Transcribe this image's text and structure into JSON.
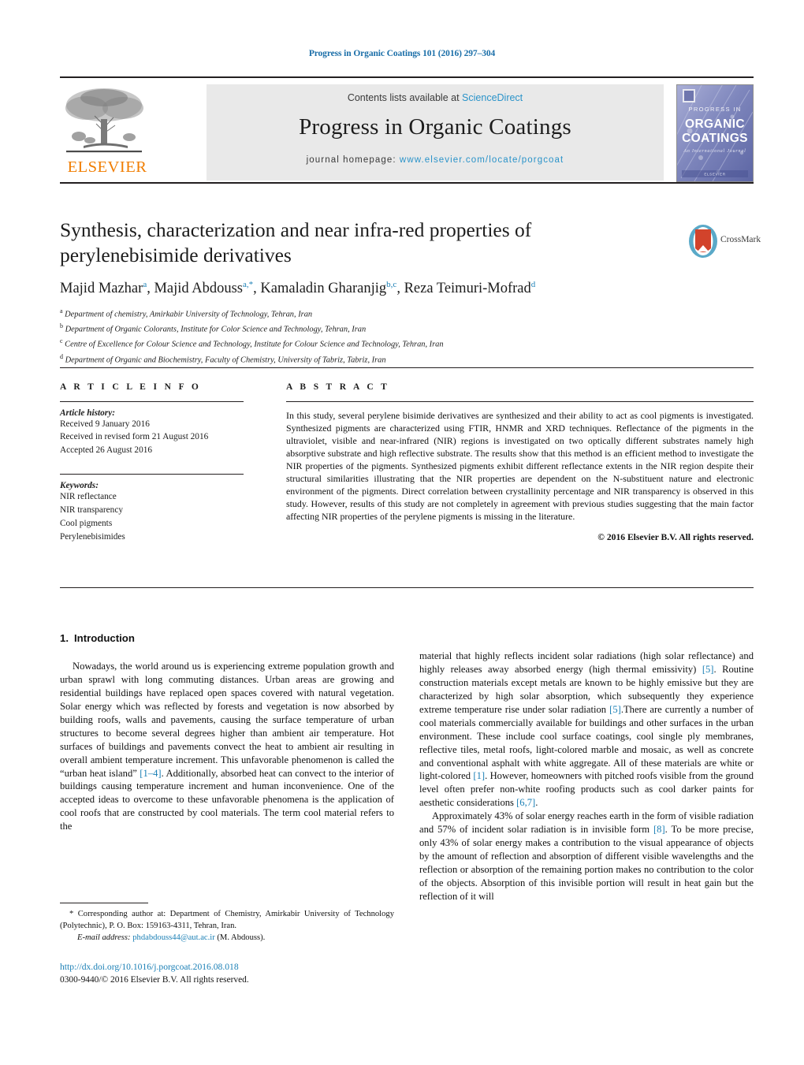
{
  "running_head": "Progress in Organic Coatings 101 (2016) 297–304",
  "masthead": {
    "contents_prefix": "Contents lists available at",
    "sciencedirect": "ScienceDirect",
    "journal_title": "Progress in Organic Coatings",
    "homepage_prefix": "journal homepage:",
    "homepage_url": "www.elsevier.com/locate/porgcoat",
    "publisher_wordmark": "ELSEVIER",
    "cover": {
      "line1": "PROGRESS IN",
      "line2": "ORGANIC",
      "line3": "COATINGS",
      "line4": "An International Journal"
    }
  },
  "article": {
    "title": "Synthesis, characterization and near infra-red properties of perylenebisimide derivatives",
    "crossmark_label": "CrossMark",
    "authors": [
      {
        "name": "Majid Mazhar",
        "sup": "a",
        "sep": ", "
      },
      {
        "name": "Majid Abdouss",
        "sup": "a,*",
        "sep": ", "
      },
      {
        "name": "Kamaladin Gharanjig",
        "sup": "b,c",
        "sep": ", "
      },
      {
        "name": "Reza Teimuri-Mofrad",
        "sup": "d",
        "sep": ""
      }
    ],
    "affiliations": [
      {
        "marker": "a",
        "text": "Department of chemistry, Amirkabir University of Technology, Tehran, Iran"
      },
      {
        "marker": "b",
        "text": "Department of Organic Colorants, Institute for Color Science and Technology, Tehran, Iran"
      },
      {
        "marker": "c",
        "text": "Centre of Excellence for Colour Science and Technology, Institute for Colour Science and Technology, Tehran, Iran"
      },
      {
        "marker": "d",
        "text": "Department of Organic and Biochemistry, Faculty of Chemistry, University of Tabriz, Tabriz, Iran"
      }
    ]
  },
  "article_info": {
    "heading": "A R T I C L E   I N F O",
    "history_label": "Article history:",
    "history": [
      "Received 9 January 2016",
      "Received in revised form 21 August 2016",
      "Accepted 26 August 2016"
    ],
    "keywords_label": "Keywords:",
    "keywords": [
      "NIR reflectance",
      "NIR transparency",
      "Cool pigments",
      "Perylenebisimides"
    ]
  },
  "abstract": {
    "heading": "A B S T R A C T",
    "text": "In this study, several perylene bisimide derivatives are synthesized and their ability to act as cool pigments is investigated. Synthesized pigments are characterized using FTIR, HNMR and XRD techniques. Reflectance of the pigments in the ultraviolet, visible and near-infrared (NIR) regions is investigated on two optically different substrates namely high absorptive substrate and high reflective substrate. The results show that this method is an efficient method to investigate the NIR properties of the pigments. Synthesized pigments exhibit different reflectance extents in the NIR region despite their structural similarities illustrating that the NIR properties are dependent on the N-substituent nature and electronic environment of the pigments. Direct correlation between crystallinity percentage and NIR transparency is observed in this study. However, results of this study are not completely in agreement with previous studies suggesting that the main factor affecting NIR properties of the perylene pigments is missing in the literature.",
    "copyright": "© 2016 Elsevier B.V. All rights reserved."
  },
  "introduction": {
    "number": "1.",
    "heading": "Introduction",
    "left_paragraph_1_a": "Nowadays, the world around us is experiencing extreme population growth and urban sprawl with long commuting distances. Urban areas are growing and residential buildings have replaced open spaces covered with natural vegetation. Solar energy which was reflected by forests and vegetation is now absorbed by building roofs, walls and pavements, causing the surface temperature of urban structures to become several degrees higher than ambient air temperature. Hot surfaces of buildings and pavements convect the heat to ambient air resulting in overall ambient temperature increment. This unfavorable phenomenon is called the “urban heat island” ",
    "ref_1_4": "[1–4]",
    "left_paragraph_1_b": ". Additionally, absorbed heat can convect to the interior of buildings causing temperature increment and human inconvenience. One of the accepted ideas to overcome to these unfavorable phenomena is the application of cool roofs that are constructed by cool materials. The term cool material refers to the",
    "right_p1_a": "material that highly reflects incident solar radiations (high solar reflectance) and highly releases away absorbed energy (high thermal emissivity) ",
    "ref_5a": "[5]",
    "right_p1_b": ". Routine construction materials except metals are known to be highly emissive but they are characterized by high solar absorption, which subsequently they experience extreme temperature rise under solar radiation ",
    "ref_5b": "[5]",
    "right_p1_c": ".There are currently a number of cool materials commercially available for buildings and other surfaces in the urban environment. These include cool surface coatings, cool single ply membranes, reflective tiles, metal roofs, light-colored marble and mosaic, as well as concrete and conventional asphalt with white aggregate. All of these materials are white or light-colored ",
    "ref_1": "[1]",
    "right_p1_d": ". However, homeowners with pitched roofs visible from the ground level often prefer non-white roofing products such as cool darker paints for aesthetic considerations ",
    "ref_6_7": "[6,7]",
    "right_p1_e": ".",
    "right_p2_a": "Approximately 43% of solar energy reaches earth in the form of visible radiation and 57% of incident solar radiation is in invisible form ",
    "ref_8": "[8]",
    "right_p2_b": ". To be more precise, only 43% of solar energy makes a contribution to the visual appearance of objects by the amount of reflection and absorption of different visible wavelengths and the reflection or absorption of the remaining portion makes no contribution to the color of the objects. Absorption of this invisible portion will result in heat gain but the reflection of it will"
  },
  "footnote": {
    "corresponding": "* Corresponding author at: Department of Chemistry, Amirkabir University of Technology (Polytechnic), P. O. Box: 159163-4311, Tehran, Iran.",
    "email_label": "E-mail address:",
    "email": "phdabdouss44@aut.ac.ir",
    "email_suffix": "(M. Abdouss)."
  },
  "footer": {
    "doi": "http://dx.doi.org/10.1016/j.porgcoat.2016.08.018",
    "issn": "0300-9440/© 2016 Elsevier B.V. All rights reserved."
  },
  "colors": {
    "link": "#1a7fb5",
    "sciencedirect": "#2a93c9",
    "elsevier_orange": "#f07d00",
    "rule": "#231f20"
  }
}
